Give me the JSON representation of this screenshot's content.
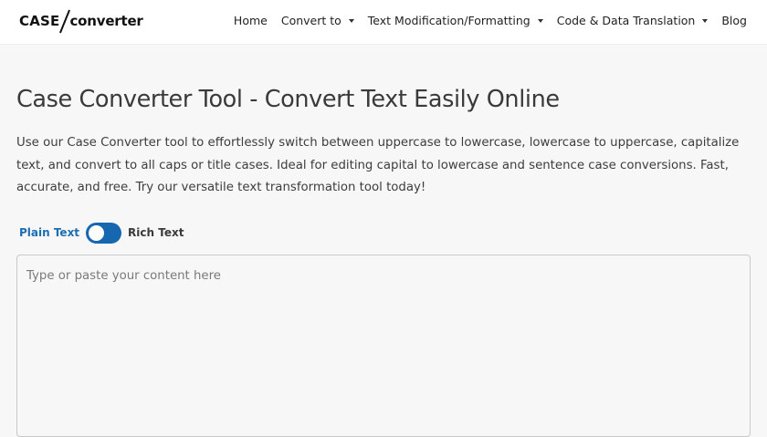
{
  "logo": {
    "part1": "CASE",
    "part2": "converter"
  },
  "nav": {
    "items": [
      {
        "label": "Home",
        "dropdown": false
      },
      {
        "label": "Convert to",
        "dropdown": true
      },
      {
        "label": "Text Modification/Formatting",
        "dropdown": true
      },
      {
        "label": "Code & Data Translation",
        "dropdown": true
      },
      {
        "label": "Blog",
        "dropdown": false
      }
    ]
  },
  "main": {
    "title": "Case Converter Tool - Convert Text Easily Online",
    "description": "Use our Case Converter tool to effortlessly switch between uppercase to lowercase, lowercase to uppercase, capitalize text, and convert to all caps or title cases. Ideal for editing capital to lowercase and sentence case conversions. Fast, accurate, and free. Try our versatile text transformation tool today!"
  },
  "mode_switch": {
    "left_label": "Plain Text",
    "right_label": "Rich Text",
    "active": "Plain Text",
    "accent_color": "#1667b0"
  },
  "editor": {
    "value": "",
    "placeholder": "Type or paste your content here"
  }
}
